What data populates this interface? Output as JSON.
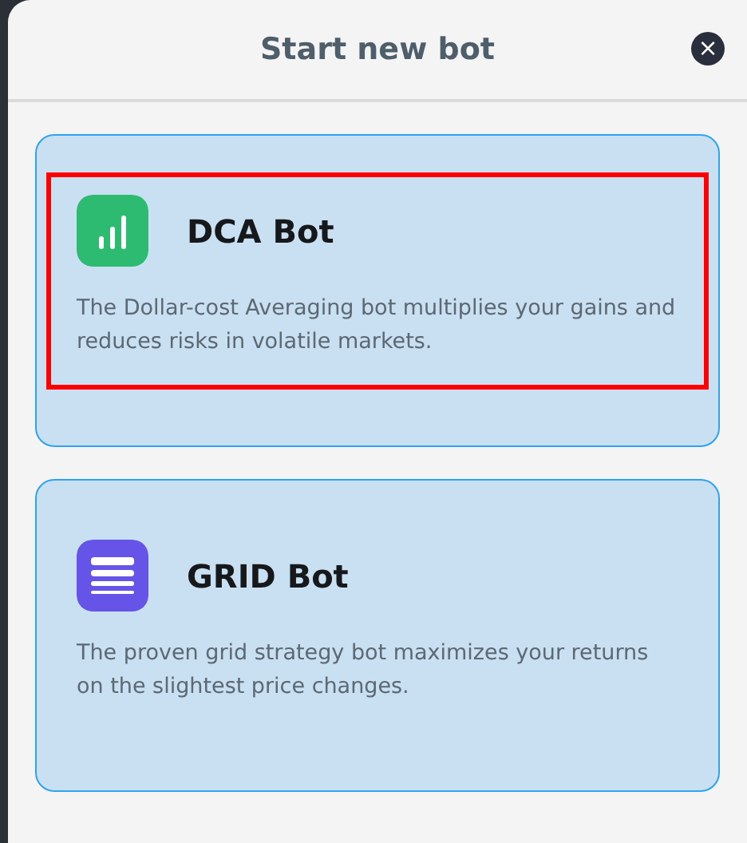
{
  "dialog": {
    "title": "Start new bot",
    "close": "×"
  },
  "bots": [
    {
      "kind": "dca",
      "name": "DCA Bot",
      "description": "The Dollar-cost Averaging bot multiplies your gains and reduces risks in volatile markets.",
      "highlighted": true
    },
    {
      "kind": "grid",
      "name": "GRID Bot",
      "description": "The proven grid strategy bot maximizes your returns on the slightest price changes.",
      "highlighted": false
    }
  ]
}
